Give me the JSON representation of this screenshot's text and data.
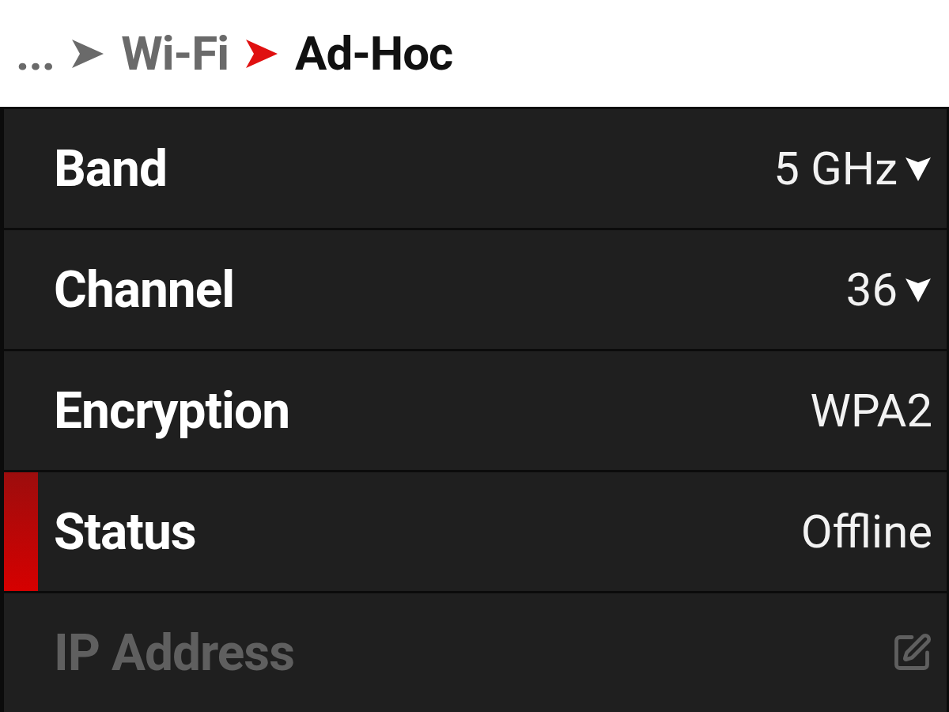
{
  "breadcrumb": [
    {
      "label": "...",
      "current": false
    },
    {
      "label": "Wi-Fi",
      "current": false
    },
    {
      "label": "Ad-Hoc",
      "current": true
    }
  ],
  "rows": [
    {
      "label": "Band",
      "value": "5 GHz",
      "kind": "dropdown",
      "selected": false,
      "disabled": false
    },
    {
      "label": "Channel",
      "value": "36",
      "kind": "dropdown",
      "selected": false,
      "disabled": false
    },
    {
      "label": "Encryption",
      "value": "WPA2",
      "kind": "text",
      "selected": false,
      "disabled": false
    },
    {
      "label": "Status",
      "value": "Offline",
      "kind": "text",
      "selected": true,
      "disabled": false
    },
    {
      "label": "IP Address",
      "kind": "edit",
      "selected": false,
      "disabled": true
    }
  ]
}
